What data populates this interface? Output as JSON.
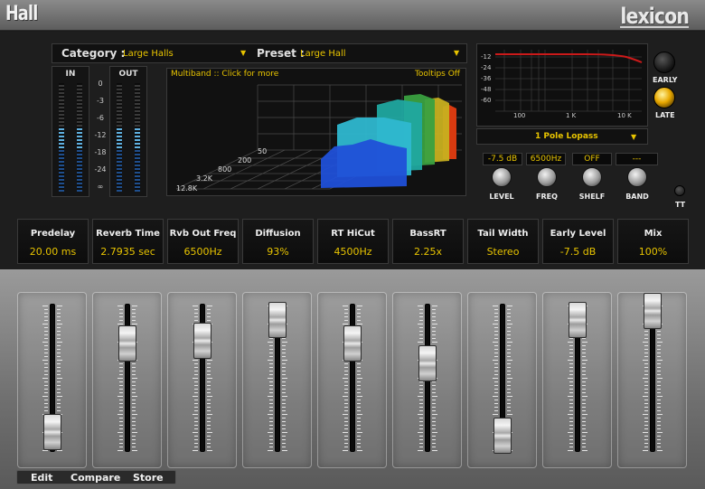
{
  "header": {
    "title": "Hall",
    "brand": "lexicon"
  },
  "selector": {
    "category_label": "Category :",
    "category_value": "Large Halls",
    "preset_label": "Preset :",
    "preset_value": "Large Hall"
  },
  "meters": {
    "in_label": "IN",
    "out_label": "OUT",
    "scale": [
      "0",
      "-3",
      "-6",
      "-12",
      "-18",
      "-24",
      "∞"
    ]
  },
  "display3d": {
    "multiband_link": "Multiband :: Click for more",
    "tooltips_toggle": "Tooltips Off",
    "freq_labels": [
      "50",
      "200",
      "800",
      "3.2K",
      "12.8K"
    ]
  },
  "eq": {
    "y_labels": [
      "-12",
      "-24",
      "-36",
      "-48",
      "-60"
    ],
    "x_labels": [
      "100",
      "1 K",
      "10 K"
    ],
    "filter_type": "1 Pole Lopass",
    "curve_color": "#cc1a1a"
  },
  "reflections": {
    "early_label": "EARLY",
    "late_label": "LATE",
    "selected": "LATE"
  },
  "knobs": [
    {
      "label": "LEVEL",
      "value": "-7.5 dB"
    },
    {
      "label": "FREQ",
      "value": "6500Hz"
    },
    {
      "label": "SHELF",
      "value": "OFF"
    },
    {
      "label": "BAND",
      "value": "---"
    }
  ],
  "tt_label": "TT",
  "params": [
    {
      "name": "Predelay",
      "value": "20.00 ms",
      "level": 0.03
    },
    {
      "name": "Reverb Time",
      "value": "2.7935 sec",
      "level": 0.74
    },
    {
      "name": "Rvb Out Freq",
      "value": "6500Hz",
      "level": 0.76
    },
    {
      "name": "Diffusion",
      "value": "93%",
      "level": 0.93
    },
    {
      "name": "RT HiCut",
      "value": "4500Hz",
      "level": 0.74
    },
    {
      "name": "BassRT",
      "value": "2.25x",
      "level": 0.58
    },
    {
      "name": "Tail Width",
      "value": "Stereo",
      "level": 0.0
    },
    {
      "name": "Early Level",
      "value": "-7.5 dB",
      "level": 0.93
    },
    {
      "name": "Mix",
      "value": "100%",
      "level": 1.0
    }
  ],
  "bottom": {
    "edit": "Edit",
    "compare": "Compare",
    "store": "Store"
  },
  "colors": {
    "accent": "#e8c400",
    "panel": "#1e1e1e",
    "meter": "#5fb0e0"
  }
}
